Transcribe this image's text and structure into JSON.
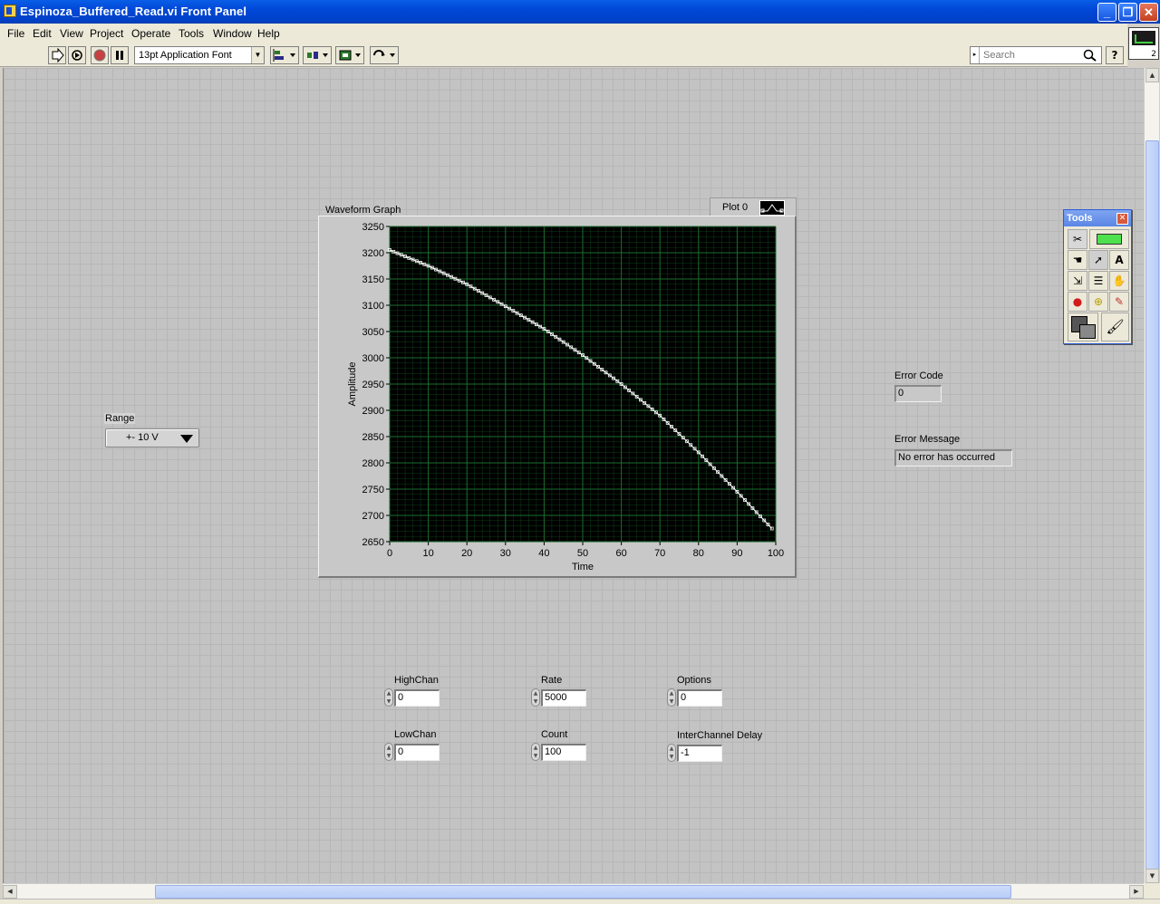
{
  "window": {
    "title": "Espinoza_Buffered_Read.vi Front Panel",
    "buttons": {
      "minimize": "_",
      "maximize": "❐",
      "close": "✕"
    }
  },
  "menu": [
    "File",
    "Edit",
    "View",
    "Project",
    "Operate",
    "Tools",
    "Window",
    "Help"
  ],
  "toolbar": {
    "font": "13pt Application Font",
    "search_placeholder": "Search",
    "help": "?",
    "vi_icon_number": "2"
  },
  "controls": {
    "range": {
      "label": "Range",
      "value": "+- 10 V"
    },
    "highchan": {
      "label": "HighChan",
      "value": "0"
    },
    "lowchan": {
      "label": "LowChan",
      "value": "0"
    },
    "rate": {
      "label": "Rate",
      "value": "5000"
    },
    "count": {
      "label": "Count",
      "value": "100"
    },
    "options": {
      "label": "Options",
      "value": "0"
    },
    "interchannel_delay": {
      "label": "InterChannel Delay",
      "value": "-1"
    }
  },
  "indicators": {
    "error_code": {
      "label": "Error Code",
      "value": "0"
    },
    "error_message": {
      "label": "Error Message",
      "value": "No error has occurred"
    }
  },
  "tools_palette": {
    "title": "Tools"
  },
  "chart_data": {
    "type": "line",
    "title": "Waveform Graph",
    "xlabel": "Time",
    "ylabel": "Amplitude",
    "xlim": [
      0,
      100
    ],
    "ylim": [
      2650,
      3250
    ],
    "xticks": [
      0,
      10,
      20,
      30,
      40,
      50,
      60,
      70,
      80,
      90,
      100
    ],
    "yticks": [
      2650,
      2700,
      2750,
      2800,
      2850,
      2900,
      2950,
      3000,
      3050,
      3100,
      3150,
      3200,
      3250
    ],
    "grid": true,
    "legend": "top-right",
    "colors": {
      "background": "#000000",
      "grid": "#1a6e2e",
      "line": "#ffffff"
    },
    "series": [
      {
        "name": "Plot 0",
        "x": [
          0,
          10,
          20,
          30,
          40,
          50,
          60,
          70,
          80,
          90,
          99
        ],
        "y": [
          3205,
          3175,
          3140,
          3098,
          3055,
          3005,
          2950,
          2890,
          2820,
          2745,
          2675
        ]
      }
    ]
  }
}
